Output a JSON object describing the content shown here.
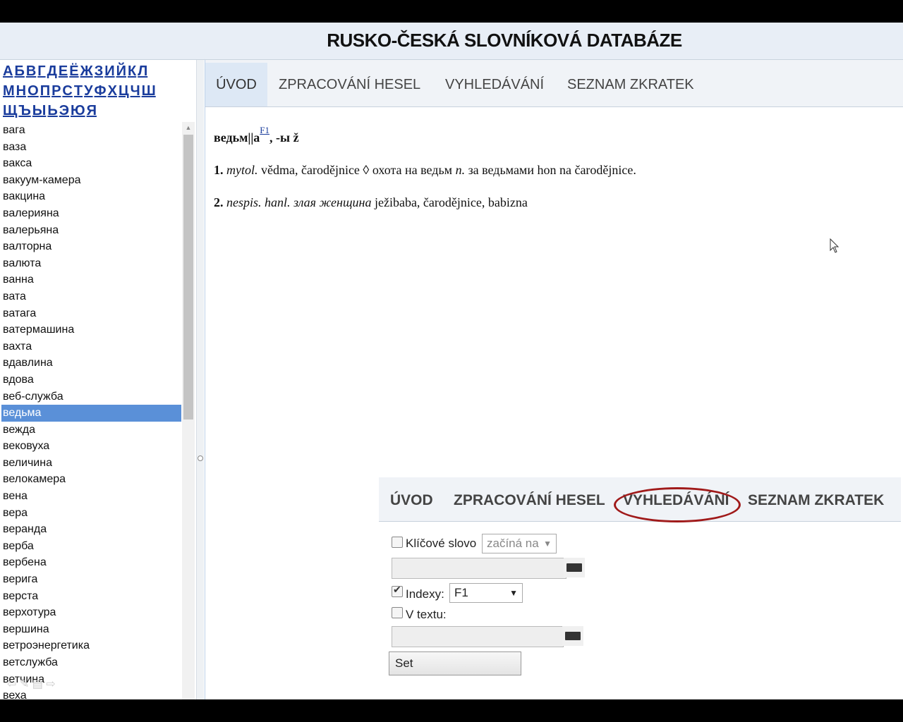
{
  "title": "RUSKO-ČESKÁ SLOVNÍKOVÁ DATABÁZE",
  "alphabet": {
    "row1": [
      "А",
      "Б",
      "В",
      "Г",
      "Д",
      "Е",
      "Ё",
      "Ж",
      "З",
      "И",
      "Й",
      "К",
      "Л"
    ],
    "row2": [
      "М",
      "Н",
      "О",
      "П",
      "Р",
      "С",
      "Т",
      "У",
      "Ф",
      "Х",
      "Ц",
      "Ч",
      "Ш"
    ],
    "row3": [
      "Щ",
      "Ъ",
      "Ы",
      "Ь",
      "Э",
      "Ю",
      "Я"
    ]
  },
  "words": [
    "вага",
    "ваза",
    "вакса",
    "вакуум-камера",
    "вакцина",
    "валерияна",
    "валерьяна",
    "валторна",
    "валюта",
    "ванна",
    "вата",
    "ватага",
    "ватермашина",
    "вахта",
    "вдавлина",
    "вдова",
    "веб-служба",
    "ведьма",
    "вежда",
    "вековуха",
    "величина",
    "велокамера",
    "вена",
    "вера",
    "веранда",
    "верба",
    "вербена",
    "верига",
    "верста",
    "верхотура",
    "вершина",
    "ветроэнергетика",
    "ветслужба",
    "ветчина",
    "веха"
  ],
  "selected_word": "ведьма",
  "tabs": [
    "ÚVOD",
    "ZPRACOVÁNÍ HESEL",
    "VYHLEDÁVÁNÍ",
    "SEZNAM ZKRATEK"
  ],
  "entry": {
    "headword": "ведьм||а",
    "sup": "F1",
    "grammar": ", -ы ž",
    "sense1_num": "1.",
    "sense1_label": "mytol.",
    "sense1_text": "vědma, čarodějnice ◊",
    "sense1_phrase": "охота на ведьм",
    "sense1_gram": "n.",
    "sense1_phrase2": "за ведьмами",
    "sense1_trans": "hon na čarodějnice.",
    "sense2_num": "2.",
    "sense2_label": "nespis. hanl.",
    "sense2_phrase": "злая женщина",
    "sense2_trans": "ježibaba, čarodějnice, babizna"
  },
  "search_form": {
    "keyword_label": "Klíčové slovo",
    "keyword_mode": "začíná na",
    "keyword_value": "",
    "indexy_label": "Indexy:",
    "indexy_value": "F1",
    "vtextu_label": "V textu:",
    "vtextu_value": "",
    "set_label": "Set"
  }
}
